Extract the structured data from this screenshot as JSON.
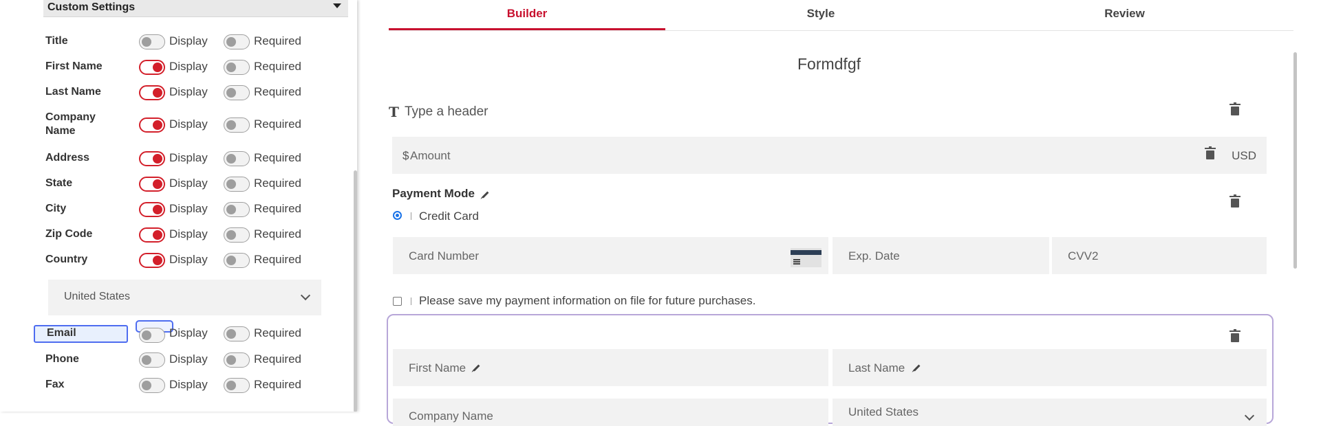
{
  "left_panel": {
    "section_title": "Custom Settings",
    "display_label": "Display",
    "required_label": "Required",
    "fields": [
      {
        "label": "Title",
        "display": false,
        "required": false
      },
      {
        "label": "First Name",
        "display": true,
        "required": false
      },
      {
        "label": "Last Name",
        "display": true,
        "required": false
      },
      {
        "label": "Company Name",
        "display": true,
        "required": false
      },
      {
        "label": "Address",
        "display": true,
        "required": false
      },
      {
        "label": "State",
        "display": true,
        "required": false
      },
      {
        "label": "City",
        "display": true,
        "required": false
      },
      {
        "label": "Zip Code",
        "display": true,
        "required": false
      },
      {
        "label": "Country",
        "display": true,
        "required": false
      },
      {
        "label": "Email",
        "display": false,
        "required": false
      },
      {
        "label": "Phone",
        "display": false,
        "required": false
      },
      {
        "label": "Fax",
        "display": false,
        "required": false
      }
    ],
    "country_select": {
      "value": "United States"
    }
  },
  "tabs": [
    {
      "label": "Builder",
      "active": true
    },
    {
      "label": "Style",
      "active": false
    },
    {
      "label": "Review",
      "active": false
    }
  ],
  "form": {
    "title": "Formdfgf",
    "header_placeholder": "Type a header",
    "amount": {
      "prefix": "$",
      "placeholder": "Amount",
      "currency": "USD"
    },
    "payment_mode": {
      "label": "Payment Mode",
      "option": "Credit Card"
    },
    "card_fields": {
      "card_number": "Card Number",
      "exp_date": "Exp. Date",
      "cvv": "CVV2"
    },
    "save_payment_label": "Please save my payment information on file for future purchases.",
    "contact_fields": {
      "first_name": "First Name",
      "last_name": "Last Name",
      "company_name": "Company Name",
      "country": "United States"
    }
  },
  "colors": {
    "accent": "#c8102e",
    "toggle_on": "#d31f2a",
    "focus": "#4d6cf0",
    "card_border": "#b7a6d8"
  }
}
